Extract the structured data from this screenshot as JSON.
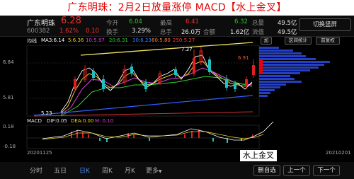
{
  "banner": {
    "title": "广东明珠：2月2日放量涨停  MACD【水上金叉】"
  },
  "stock": {
    "name": "广东明珠",
    "price": "6.28",
    "code": "600382",
    "change_pct": "1.62%",
    "change": "0.10",
    "today_label": "今开",
    "today_value": "6.04",
    "high_label": "最高",
    "high_value": "6.41",
    "high2_value": "6.32",
    "vol_label": "总量",
    "vol_value": "49.5亿",
    "turnover_label": "换手",
    "turnover_value": "3.29%",
    "amount_label": "总手",
    "amount_value": "26.0万",
    "amount2_label": "合额",
    "amount2_value": "1.62亿",
    "circ_label": "流值",
    "circ_value": "49.5亿"
  },
  "switch_button": "切换竖屏",
  "chart_toolbar": {
    "left": "均线",
    "b1": "加",
    "b2": "区间统计",
    "b3": "前复权"
  },
  "ma": {
    "ma5": "MA3:6.14",
    "ma10": "5:6.36",
    "ma20": "10:5.97",
    "ma30": "20:6.31",
    "ma60": "30:6.23",
    "ma120": "60:5.80",
    "ma250": "250:5.27"
  },
  "price_axis": {
    "top": "6.91",
    "mid1": "6.84",
    "mid2": "5.81",
    "low": "5.23",
    "peak": "7.37"
  },
  "macd": {
    "label": "MACD",
    "dif": "DIF:0.05",
    "dea": "DEA:0.00",
    "m": "M: 0.10",
    "top": "0.18",
    "bot": "-0.18"
  },
  "dates": {
    "start": "20201125",
    "end": "20210201"
  },
  "callout": "水上金叉",
  "bottom_tabs": [
    "分时",
    "五日",
    "日K",
    "周K",
    "月K",
    "更多"
  ],
  "bottom_tab_icons": [
    "",
    "",
    "",
    "",
    "",
    "chevron-down-icon"
  ],
  "bottom_buttons": [
    "删自选",
    "上一个",
    "下一个"
  ]
}
